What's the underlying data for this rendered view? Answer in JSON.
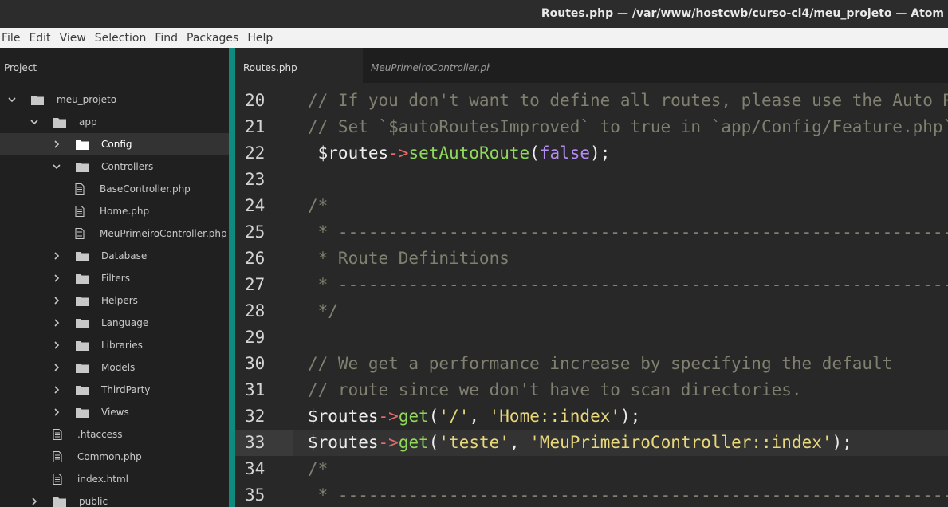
{
  "window": {
    "title": "Routes.php — /var/www/hostcwb/curso-ci4/meu_projeto — Atom"
  },
  "menu": [
    "File",
    "Edit",
    "View",
    "Selection",
    "Find",
    "Packages",
    "Help"
  ],
  "sidebar": {
    "title": "Project",
    "tree": [
      {
        "label": "meu_projeto",
        "type": "folder",
        "depth": 0,
        "expanded": true,
        "selected": false
      },
      {
        "label": "app",
        "type": "folder",
        "depth": 1,
        "expanded": true,
        "selected": false
      },
      {
        "label": "Config",
        "type": "folder",
        "depth": 2,
        "expanded": false,
        "selected": true
      },
      {
        "label": "Controllers",
        "type": "folder",
        "depth": 2,
        "expanded": true,
        "selected": false
      },
      {
        "label": "BaseController.php",
        "type": "file",
        "depth": 3,
        "selected": false
      },
      {
        "label": "Home.php",
        "type": "file",
        "depth": 3,
        "selected": false
      },
      {
        "label": "MeuPrimeiroController.php",
        "type": "file",
        "depth": 3,
        "selected": false
      },
      {
        "label": "Database",
        "type": "folder",
        "depth": 2,
        "expanded": false,
        "selected": false
      },
      {
        "label": "Filters",
        "type": "folder",
        "depth": 2,
        "expanded": false,
        "selected": false
      },
      {
        "label": "Helpers",
        "type": "folder",
        "depth": 2,
        "expanded": false,
        "selected": false
      },
      {
        "label": "Language",
        "type": "folder",
        "depth": 2,
        "expanded": false,
        "selected": false
      },
      {
        "label": "Libraries",
        "type": "folder",
        "depth": 2,
        "expanded": false,
        "selected": false
      },
      {
        "label": "Models",
        "type": "folder",
        "depth": 2,
        "expanded": false,
        "selected": false
      },
      {
        "label": "ThirdParty",
        "type": "folder",
        "depth": 2,
        "expanded": false,
        "selected": false
      },
      {
        "label": "Views",
        "type": "folder",
        "depth": 2,
        "expanded": false,
        "selected": false
      },
      {
        "label": ".htaccess",
        "type": "file",
        "depth": 2,
        "selected": false
      },
      {
        "label": "Common.php",
        "type": "file",
        "depth": 2,
        "selected": false
      },
      {
        "label": "index.html",
        "type": "file",
        "depth": 2,
        "selected": false
      },
      {
        "label": "public",
        "type": "folder",
        "depth": 1,
        "expanded": false,
        "selected": false
      }
    ]
  },
  "tabs": [
    {
      "label": "Routes.php",
      "active": true
    },
    {
      "label": "MeuPrimeiroController.php",
      "active": false
    }
  ],
  "editor": {
    "cursor_line": 33,
    "lines": [
      {
        "num": "20",
        "tokens": [
          [
            "c-comment",
            "// If you don't want to define all routes, please use the Auto Routing (Improved)."
          ]
        ]
      },
      {
        "num": "21",
        "tokens": [
          [
            "c-comment",
            "// Set `$autoRoutesImproved` to true in `app/Config/Feature.php` and set the following to true."
          ]
        ]
      },
      {
        "num": "22",
        "tokens": [
          [
            "c-var",
            " $routes"
          ],
          [
            "c-op",
            "->"
          ],
          [
            "c-fn",
            "setAutoRoute"
          ],
          [
            "c-punct",
            "("
          ],
          [
            "c-kw",
            "false"
          ],
          [
            "c-punct",
            ");"
          ]
        ]
      },
      {
        "num": "23",
        "tokens": []
      },
      {
        "num": "24",
        "tokens": [
          [
            "c-comment",
            "/*"
          ]
        ]
      },
      {
        "num": "25",
        "tokens": [
          [
            "c-comment",
            " * --------------------------------------------------------------------"
          ]
        ]
      },
      {
        "num": "26",
        "tokens": [
          [
            "c-comment",
            " * Route Definitions"
          ]
        ]
      },
      {
        "num": "27",
        "tokens": [
          [
            "c-comment",
            " * --------------------------------------------------------------------"
          ]
        ]
      },
      {
        "num": "28",
        "tokens": [
          [
            "c-comment",
            " */"
          ]
        ]
      },
      {
        "num": "29",
        "tokens": []
      },
      {
        "num": "30",
        "tokens": [
          [
            "c-comment",
            "// We get a performance increase by specifying the default"
          ]
        ]
      },
      {
        "num": "31",
        "tokens": [
          [
            "c-comment",
            "// route since we don't have to scan directories."
          ]
        ]
      },
      {
        "num": "32",
        "tokens": [
          [
            "c-var",
            "$routes"
          ],
          [
            "c-op",
            "->"
          ],
          [
            "c-fn",
            "get"
          ],
          [
            "c-punct",
            "("
          ],
          [
            "c-str",
            "'/'"
          ],
          [
            "c-punct",
            ", "
          ],
          [
            "c-str",
            "'Home::index'"
          ],
          [
            "c-punct",
            ");"
          ]
        ]
      },
      {
        "num": "33",
        "tokens": [
          [
            "c-var",
            "$routes"
          ],
          [
            "c-op",
            "->"
          ],
          [
            "c-fn",
            "get"
          ],
          [
            "c-punct",
            "("
          ],
          [
            "c-str",
            "'teste'"
          ],
          [
            "c-punct",
            ", "
          ],
          [
            "c-str",
            "'MeuPrimeiroController::index'"
          ],
          [
            "c-punct",
            ");"
          ]
        ]
      },
      {
        "num": "34",
        "tokens": [
          [
            "c-comment",
            "/*"
          ]
        ]
      },
      {
        "num": "35",
        "tokens": [
          [
            "c-comment",
            " * --------------------------------------------------------------------"
          ]
        ]
      }
    ]
  }
}
